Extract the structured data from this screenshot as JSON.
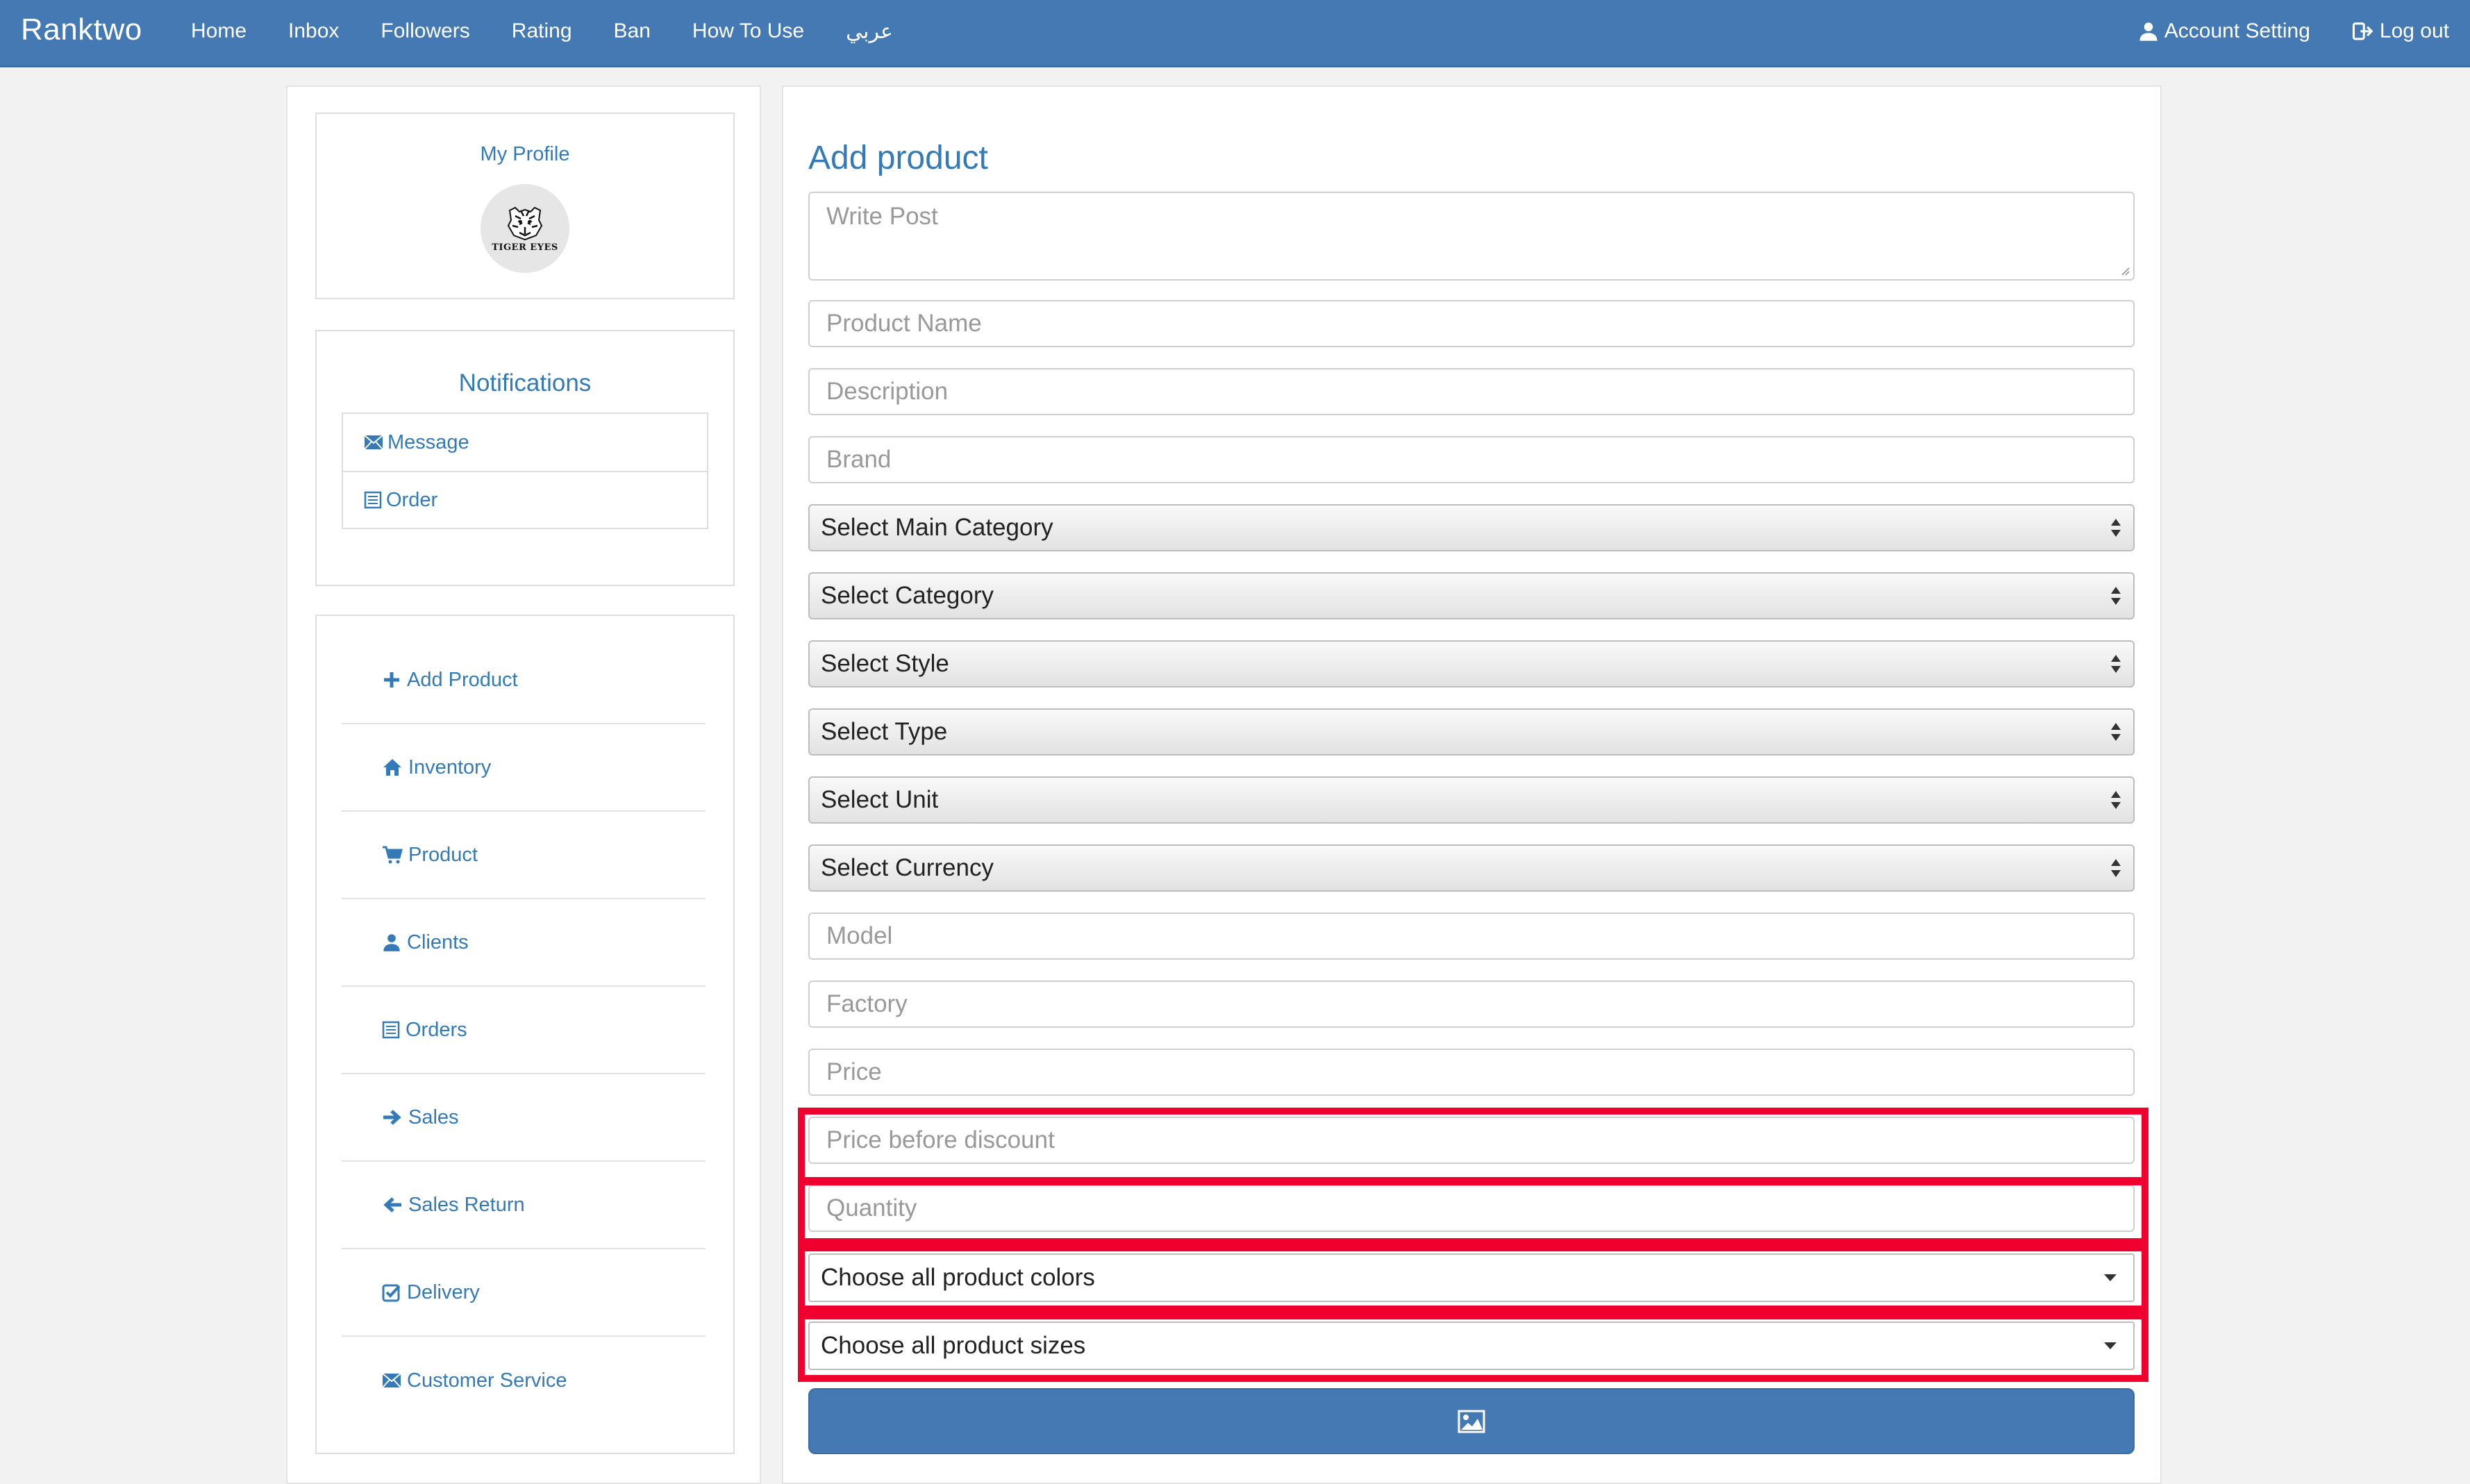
{
  "nav": {
    "brand": "Ranktwo",
    "items": [
      "Home",
      "Inbox",
      "Followers",
      "Rating",
      "Ban",
      "How To Use",
      "عربي"
    ],
    "account_setting": "Account Setting",
    "logout": "Log out"
  },
  "profile": {
    "title": "My Profile",
    "avatar_text": "TIGER EYES"
  },
  "notifications": {
    "title": "Notifications",
    "items": [
      "Message",
      "Order"
    ]
  },
  "menu": {
    "items": [
      "Add Product",
      "Inventory",
      "Product",
      "Clients",
      "Orders",
      "Sales",
      "Sales Return",
      "Delivery",
      "Customer Service"
    ]
  },
  "form": {
    "title": "Add product",
    "write_post": "Write Post",
    "product_name": "Product Name",
    "description": "Description",
    "brand": "Brand",
    "main_category": "Select Main Category",
    "category": "Select Category",
    "style": "Select Style",
    "type": "Select Type",
    "unit": "Select Unit",
    "currency": "Select Currency",
    "model": "Model",
    "factory": "Factory",
    "price": "Price",
    "price_before_discount": "Price before discount",
    "quantity": "Quantity",
    "colors": "Choose all product colors",
    "sizes": "Choose all product sizes"
  },
  "colors": {
    "navbar": "#4479b4",
    "link": "#337ab7",
    "highlight": "#f0002e"
  }
}
